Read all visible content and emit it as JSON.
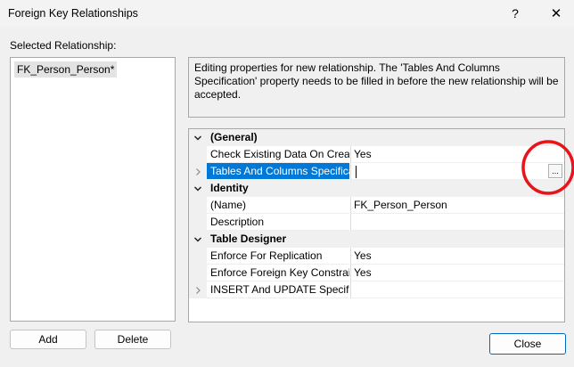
{
  "window": {
    "title": "Foreign Key Relationships",
    "help_label": "?",
    "close_glyph": "✕"
  },
  "left": {
    "label": "Selected Relationship:",
    "items": [
      "FK_Person_Person*"
    ],
    "add_label": "Add",
    "delete_label": "Delete"
  },
  "description": "Editing properties for new relationship.  The 'Tables And Columns Specification' property needs to be filled in before the new relationship will be accepted.",
  "grid": {
    "rows": [
      {
        "kind": "category",
        "name": "(General)",
        "expander": "chevron-down"
      },
      {
        "kind": "prop",
        "name": "Check Existing Data On Creat",
        "value": "Yes"
      },
      {
        "kind": "prop",
        "name": "Tables And Columns Specifica",
        "value": "",
        "expander": "chevron-right",
        "selected": true,
        "ellipsis": "..."
      },
      {
        "kind": "category",
        "name": "Identity",
        "expander": "chevron-down"
      },
      {
        "kind": "prop",
        "name": "(Name)",
        "value": "FK_Person_Person"
      },
      {
        "kind": "prop",
        "name": "Description",
        "value": ""
      },
      {
        "kind": "category",
        "name": "Table Designer",
        "expander": "chevron-down"
      },
      {
        "kind": "prop",
        "name": "Enforce For Replication",
        "value": "Yes"
      },
      {
        "kind": "prop",
        "name": "Enforce Foreign Key Constrain",
        "value": "Yes"
      },
      {
        "kind": "prop",
        "name": "INSERT And UPDATE Specifica",
        "value": "",
        "expander": "chevron-right"
      }
    ]
  },
  "close_label": "Close",
  "colors": {
    "selection": "#0078d7",
    "annotation": "#e8141c",
    "accent_border": "#0067c0"
  },
  "icons": {
    "chevron_down": "chevron-down-icon",
    "chevron_right": "chevron-right-icon",
    "ellipsis": "ellipsis-icon"
  }
}
